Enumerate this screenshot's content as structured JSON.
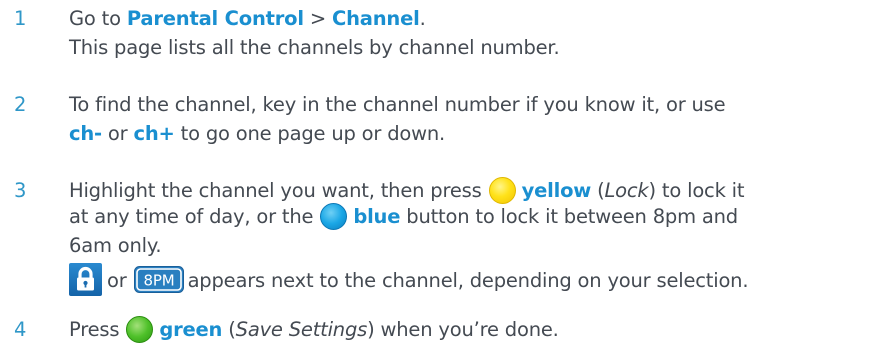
{
  "steps": [
    {
      "number": "1",
      "line1": {
        "pre": "Go to ",
        "b1": "Parental Control",
        "mid": " > ",
        "b2": "Channel",
        "post": "."
      },
      "line2": "This page lists all the channels by channel number."
    },
    {
      "number": "2",
      "line1": "To find the channel, key in the channel number if you know it, or use",
      "line2": {
        "b1": "ch-",
        "mid": " or ",
        "b2": "ch+",
        "post": " to go one page up or down."
      }
    },
    {
      "number": "3",
      "line1": {
        "pre": "Highlight the channel you want, then press",
        "b1": "yellow",
        "p1": " (",
        "i1": "Lock",
        "p2": ") to lock it"
      },
      "line2": {
        "pre": "at any time of day, or the",
        "b1": "blue",
        "post": " button to lock it between 8pm and"
      },
      "line3": "6am only.",
      "line4": {
        "mid": "or",
        "post": "appears next to the channel, depending on your selection."
      },
      "icons": {
        "lock": "padlock-icon",
        "timer": "8pm-icon",
        "timer_text": "8PM"
      }
    },
    {
      "number": "4",
      "line1": {
        "pre": "Press",
        "b1": "green",
        "p1": " (",
        "i1": "Save Settings",
        "p2": ") when you’re done."
      }
    }
  ],
  "colors": {
    "number": "#2f97c8",
    "highlight": "#1a8fd0",
    "text": "#444a52",
    "yellow": "#ffe21a",
    "blue": "#1aa7e6",
    "green": "#4fc12a"
  }
}
